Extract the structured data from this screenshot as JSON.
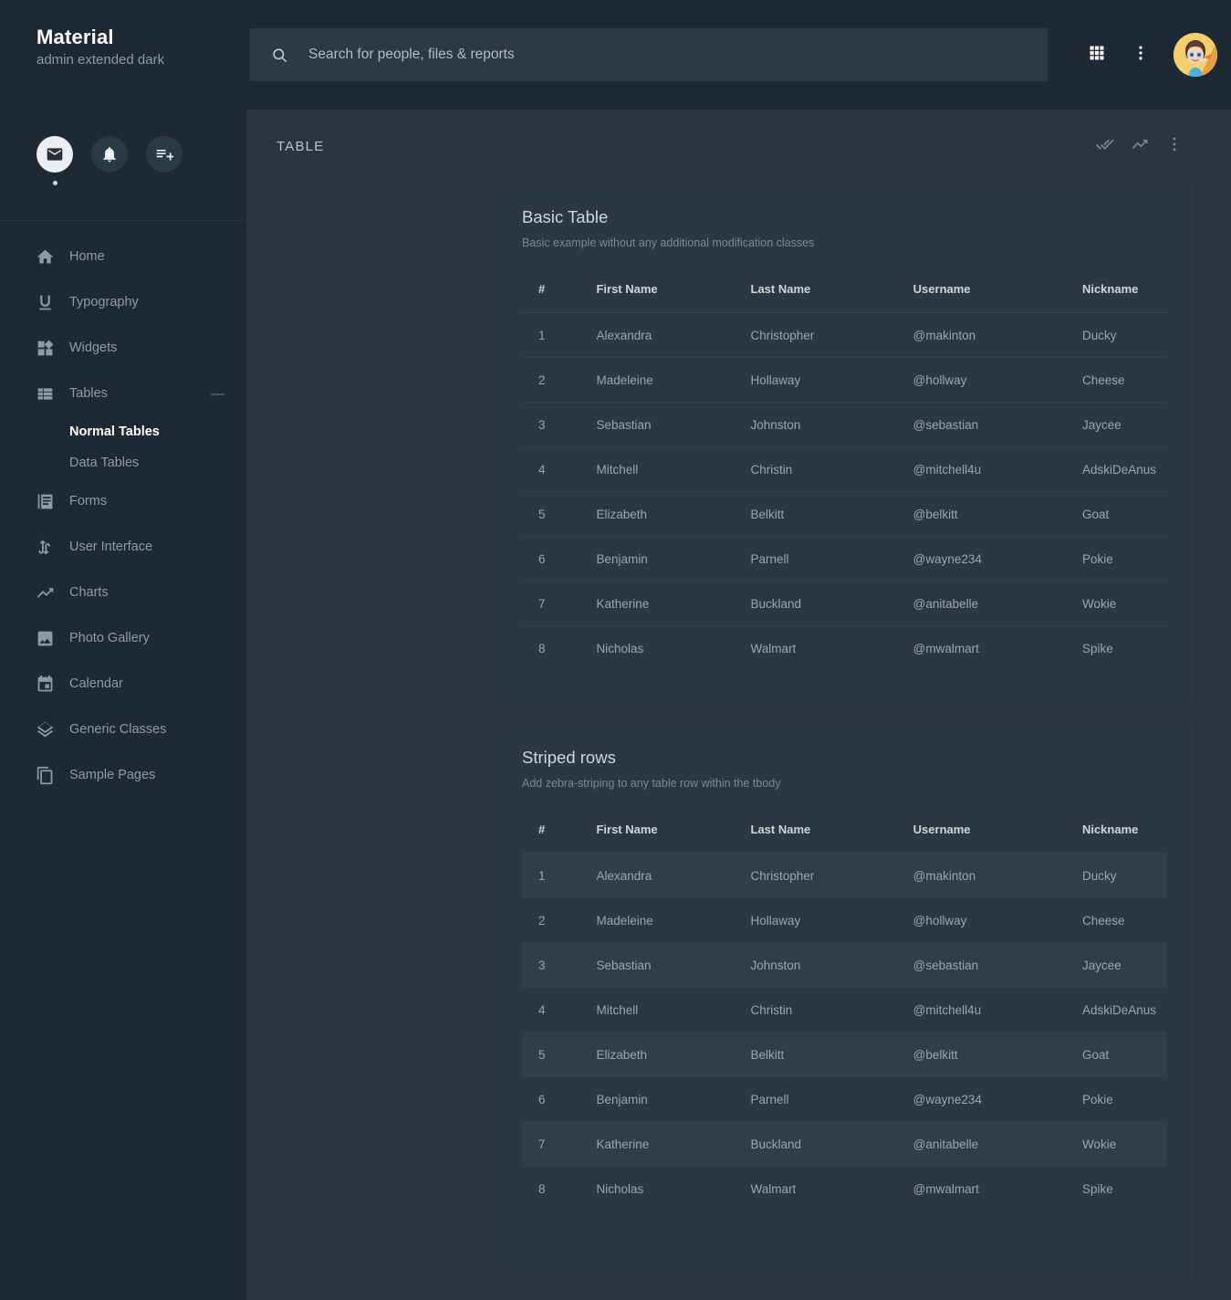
{
  "brand": {
    "title": "Material",
    "subtitle": "admin extended dark"
  },
  "quick_actions": [
    {
      "name": "mail-icon",
      "active": true
    },
    {
      "name": "bell-icon",
      "active": false
    },
    {
      "name": "playlist-add-icon",
      "active": false
    }
  ],
  "sidebar": {
    "items": [
      {
        "label": "Home",
        "icon": "home-icon"
      },
      {
        "label": "Typography",
        "icon": "underline-u-icon"
      },
      {
        "label": "Widgets",
        "icon": "widgets-icon"
      },
      {
        "label": "Tables",
        "icon": "table-list-icon",
        "collapse_glyph": "—",
        "expanded": true
      },
      {
        "label": "Forms",
        "icon": "forms-icon"
      },
      {
        "label": "User Interface",
        "icon": "swap-vertical-icon"
      },
      {
        "label": "Charts",
        "icon": "trending-up-icon"
      },
      {
        "label": "Photo Gallery",
        "icon": "image-icon"
      },
      {
        "label": "Calendar",
        "icon": "calendar-icon"
      },
      {
        "label": "Generic Classes",
        "icon": "layers-icon"
      },
      {
        "label": "Sample Pages",
        "icon": "copy-pages-icon"
      }
    ],
    "sub_items": [
      {
        "label": "Normal Tables",
        "active": true
      },
      {
        "label": "Data Tables",
        "active": false
      }
    ]
  },
  "topbar": {
    "search": {
      "placeholder": "Search for people, files & reports",
      "value": "",
      "icon": "search-icon"
    },
    "apps_icon": "apps-grid-icon",
    "more_icon": "more-vertical-icon",
    "avatar": "user-avatar"
  },
  "page": {
    "title": "TABLE",
    "actions": [
      {
        "name": "done-all-icon"
      },
      {
        "name": "trending-up-icon"
      },
      {
        "name": "more-vertical-icon"
      }
    ]
  },
  "tables": [
    {
      "id": "basic-table",
      "title": "Basic Table",
      "subtitle": "Basic example without any additional modification classes",
      "striped": false,
      "columns": [
        "#",
        "First Name",
        "Last Name",
        "Username",
        "Nickname"
      ],
      "rows": [
        [
          "1",
          "Alexandra",
          "Christopher",
          "@makinton",
          "Ducky"
        ],
        [
          "2",
          "Madeleine",
          "Hollaway",
          "@hollway",
          "Cheese"
        ],
        [
          "3",
          "Sebastian",
          "Johnston",
          "@sebastian",
          "Jaycee"
        ],
        [
          "4",
          "Mitchell",
          "Christin",
          "@mitchell4u",
          "AdskiDeAnus"
        ],
        [
          "5",
          "Elizabeth",
          "Belkitt",
          "@belkitt",
          "Goat"
        ],
        [
          "6",
          "Benjamin",
          "Parnell",
          "@wayne234",
          "Pokie"
        ],
        [
          "7",
          "Katherine",
          "Buckland",
          "@anitabelle",
          "Wokie"
        ],
        [
          "8",
          "Nicholas",
          "Walmart",
          "@mwalmart",
          "Spike"
        ]
      ]
    },
    {
      "id": "striped-table",
      "title": "Striped rows",
      "subtitle": "Add zebra-striping to any table row within the tbody",
      "striped": true,
      "columns": [
        "#",
        "First Name",
        "Last Name",
        "Username",
        "Nickname"
      ],
      "rows": [
        [
          "1",
          "Alexandra",
          "Christopher",
          "@makinton",
          "Ducky"
        ],
        [
          "2",
          "Madeleine",
          "Hollaway",
          "@hollway",
          "Cheese"
        ],
        [
          "3",
          "Sebastian",
          "Johnston",
          "@sebastian",
          "Jaycee"
        ],
        [
          "4",
          "Mitchell",
          "Christin",
          "@mitchell4u",
          "AdskiDeAnus"
        ],
        [
          "5",
          "Elizabeth",
          "Belkitt",
          "@belkitt",
          "Goat"
        ],
        [
          "6",
          "Benjamin",
          "Parnell",
          "@wayne234",
          "Pokie"
        ],
        [
          "7",
          "Katherine",
          "Buckland",
          "@anitabelle",
          "Wokie"
        ],
        [
          "8",
          "Nicholas",
          "Walmart",
          "@mwalmart",
          "Spike"
        ]
      ]
    }
  ],
  "colors": {
    "sidebar_bg": "#1e2a33",
    "page_bg": "#2b353f",
    "card_bg": "#2b3742",
    "stripe_bg": "#313d48",
    "text_muted": "#8e9aa4",
    "text_bright": "#ffffff"
  }
}
